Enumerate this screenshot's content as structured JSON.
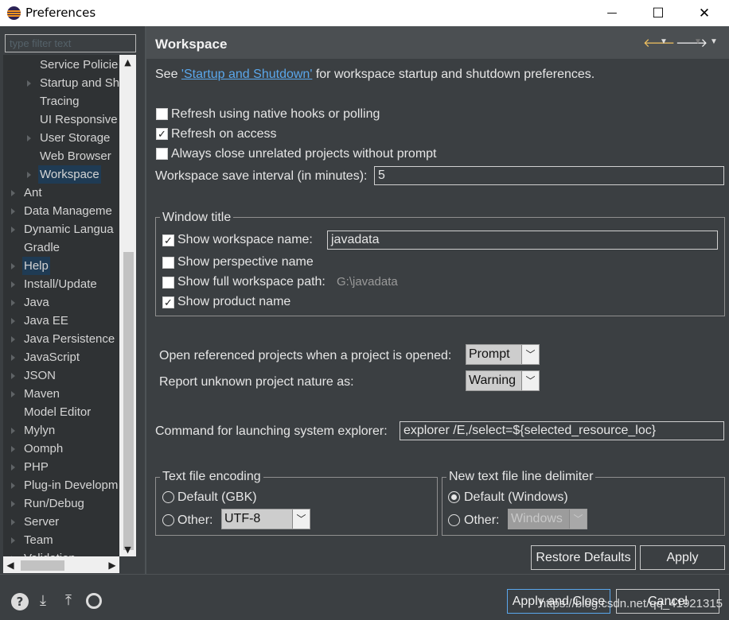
{
  "window": {
    "title": "Preferences",
    "minimize_glyph": "—",
    "maximize_glyph": "☐",
    "close_glyph": "✕"
  },
  "filter": {
    "placeholder": "type filter text"
  },
  "tree": {
    "items": [
      {
        "label": "Service Policie",
        "level": 2,
        "has_children": false,
        "selected": false
      },
      {
        "label": "Startup and Sh",
        "level": 2,
        "has_children": true,
        "selected": false
      },
      {
        "label": "Tracing",
        "level": 2,
        "has_children": false,
        "selected": false
      },
      {
        "label": "UI Responsive",
        "level": 2,
        "has_children": false,
        "selected": false
      },
      {
        "label": "User Storage",
        "level": 2,
        "has_children": true,
        "selected": false
      },
      {
        "label": "Web Browser",
        "level": 2,
        "has_children": false,
        "selected": false
      },
      {
        "label": "Workspace",
        "level": 2,
        "has_children": true,
        "selected": true
      },
      {
        "label": "Ant",
        "level": 1,
        "has_children": true,
        "selected": false
      },
      {
        "label": "Data Manageme",
        "level": 1,
        "has_children": true,
        "selected": false
      },
      {
        "label": "Dynamic Langua",
        "level": 1,
        "has_children": true,
        "selected": false
      },
      {
        "label": "Gradle",
        "level": 1,
        "has_children": false,
        "selected": false
      },
      {
        "label": "Help",
        "level": 1,
        "has_children": true,
        "selected": false,
        "highlight": true
      },
      {
        "label": "Install/Update",
        "level": 1,
        "has_children": true,
        "selected": false
      },
      {
        "label": "Java",
        "level": 1,
        "has_children": true,
        "selected": false
      },
      {
        "label": "Java EE",
        "level": 1,
        "has_children": true,
        "selected": false
      },
      {
        "label": "Java Persistence",
        "level": 1,
        "has_children": true,
        "selected": false
      },
      {
        "label": "JavaScript",
        "level": 1,
        "has_children": true,
        "selected": false
      },
      {
        "label": "JSON",
        "level": 1,
        "has_children": true,
        "selected": false
      },
      {
        "label": "Maven",
        "level": 1,
        "has_children": true,
        "selected": false
      },
      {
        "label": "Model Editor",
        "level": 1,
        "has_children": false,
        "selected": false
      },
      {
        "label": "Mylyn",
        "level": 1,
        "has_children": true,
        "selected": false
      },
      {
        "label": "Oomph",
        "level": 1,
        "has_children": true,
        "selected": false
      },
      {
        "label": "PHP",
        "level": 1,
        "has_children": true,
        "selected": false
      },
      {
        "label": "Plug-in Developm",
        "level": 1,
        "has_children": true,
        "selected": false
      },
      {
        "label": "Run/Debug",
        "level": 1,
        "has_children": true,
        "selected": false
      },
      {
        "label": "Server",
        "level": 1,
        "has_children": true,
        "selected": false
      },
      {
        "label": "Team",
        "level": 1,
        "has_children": true,
        "selected": false
      },
      {
        "label": "Validation",
        "level": 1,
        "has_children": true,
        "selected": false
      }
    ]
  },
  "page": {
    "title": "Workspace",
    "intro_prefix": "See ",
    "intro_link": "'Startup and Shutdown'",
    "intro_suffix": " for workspace startup and shutdown preferences.",
    "refresh_native": {
      "label": "Refresh using native hooks or polling",
      "checked": false
    },
    "refresh_access": {
      "label": "Refresh on access",
      "checked": true
    },
    "always_close": {
      "label": "Always close unrelated projects without prompt",
      "checked": false
    },
    "save_interval": {
      "label": "Workspace save interval (in minutes):",
      "value": "5"
    },
    "window_title": {
      "group_label": "Window title",
      "show_workspace_name": {
        "label": "Show workspace name:",
        "checked": true,
        "value": "javadata"
      },
      "show_perspective_name": {
        "label": "Show perspective name",
        "checked": false
      },
      "show_full_path": {
        "label": "Show full workspace path:",
        "checked": false,
        "value": "G:\\javadata"
      },
      "show_product_name": {
        "label": "Show product name",
        "checked": true
      }
    },
    "open_referenced": {
      "label": "Open referenced projects when a project is opened:",
      "value": "Prompt"
    },
    "report_unknown": {
      "label": "Report unknown project nature as:",
      "value": "Warning"
    },
    "explorer_cmd": {
      "label": "Command for launching system explorer:",
      "value": "explorer /E,/select=${selected_resource_loc}"
    },
    "encoding": {
      "group_label": "Text file encoding",
      "default_label": "Default (GBK)",
      "other_label": "Other:",
      "other_value": "UTF-8"
    },
    "delimiter": {
      "group_label": "New text file line delimiter",
      "default_label": "Default (Windows)",
      "other_label": "Other:",
      "other_value": "Windows"
    },
    "restore_defaults": "Restore Defaults",
    "apply": "Apply"
  },
  "footer": {
    "apply_close": "Apply and Close",
    "cancel": "Cancel",
    "watermark": "https://blog.csdn.net/qq_41921315"
  },
  "colors": {
    "background": "#3b3f42",
    "tree_bg": "#2f3234",
    "link": "#5aa7ec",
    "selection": "#1f3b54"
  }
}
